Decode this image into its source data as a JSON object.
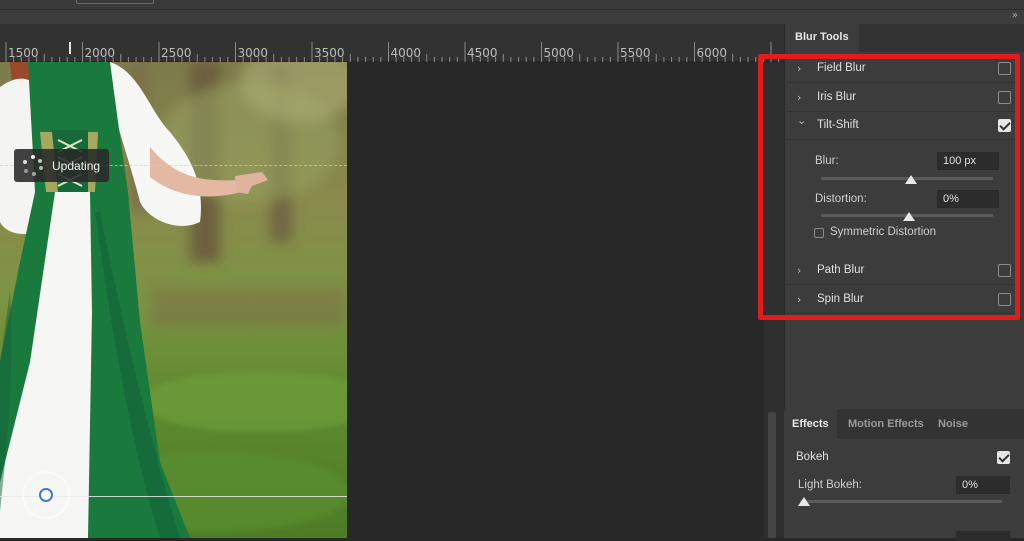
{
  "ruler": {
    "labels": [
      "1500",
      "2000",
      "2500",
      "3000",
      "3500",
      "4000",
      "4500",
      "5000",
      "5500",
      "6000"
    ]
  },
  "canvas": {
    "status_text": "Updating"
  },
  "panel": {
    "title": "Blur Tools",
    "blur_rows": [
      {
        "label": "Field Blur",
        "checked": false,
        "expanded": false
      },
      {
        "label": "Iris Blur",
        "checked": false,
        "expanded": false
      },
      {
        "label": "Tilt-Shift",
        "checked": true,
        "expanded": true
      },
      {
        "label": "Path Blur",
        "checked": false,
        "expanded": false
      },
      {
        "label": "Spin Blur",
        "checked": false,
        "expanded": false
      }
    ],
    "tilt_shift": {
      "blur_label": "Blur:",
      "blur_value": "100 px",
      "blur_slider_fraction": 0.5,
      "distortion_label": "Distortion:",
      "distortion_value": "0%",
      "distortion_slider_fraction": 0.5,
      "symmetric_label": "Symmetric Distortion",
      "symmetric_checked": false
    }
  },
  "effects": {
    "tabs": [
      "Effects",
      "Motion Effects",
      "Noise"
    ],
    "active_tab": "Effects",
    "bokeh_label": "Bokeh",
    "bokeh_checked": true,
    "light_bokeh_label": "Light Bokeh:",
    "light_bokeh_value": "0%",
    "light_bokeh_fraction": 0.0
  },
  "colors": {
    "highlight": "#e21b1b",
    "dress_green": "#1a7a3e",
    "accent_blue": "#3a7bd5"
  }
}
